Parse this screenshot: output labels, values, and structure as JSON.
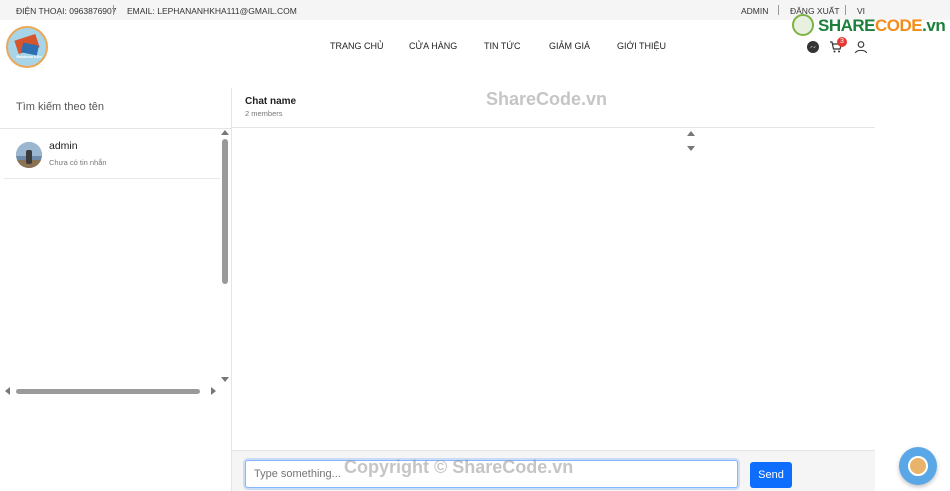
{
  "topbar": {
    "phone": "ĐIỆN THOẠI: 0963876907",
    "email": "EMAIL: LEPHANANHKHA111@GMAIL.COM",
    "admin": "ADMIN",
    "logout": "ĐĂNG XUẤT",
    "lang": "VI"
  },
  "logo": {
    "text": "Rainbow Kite"
  },
  "nav": {
    "items": [
      {
        "label": "TRANG CHỦ"
      },
      {
        "label": "CỬA HÀNG"
      },
      {
        "label": "TIN TỨC"
      },
      {
        "label": "GIẢM GIÁ"
      },
      {
        "label": "GIỚI THIỆU"
      }
    ],
    "cart_count": "3"
  },
  "sharecode_logo": {
    "part1": "SHARE",
    "part2": "CODE",
    "part3": ".vn"
  },
  "sidebar": {
    "search_label": "Tìm kiếm theo tên",
    "contacts": [
      {
        "name": "admin",
        "preview": "Chưa có tin nhắn"
      }
    ]
  },
  "chat": {
    "name": "Chat name",
    "members": "2 members",
    "input_placeholder": "Type something...",
    "send_label": "Send"
  },
  "watermarks": {
    "top": "ShareCode.vn",
    "bottom": "Copyright © ShareCode.vn"
  },
  "colors": {
    "accent": "#0d6efd",
    "badge": "#e53935",
    "sharecode_green": "#1d7f3c",
    "sharecode_orange": "#f28c1a"
  },
  "icons": [
    "messenger-icon",
    "cart-icon",
    "user-icon",
    "scroll-up-icon",
    "scroll-down-icon",
    "scroll-left-icon",
    "scroll-right-icon"
  ]
}
